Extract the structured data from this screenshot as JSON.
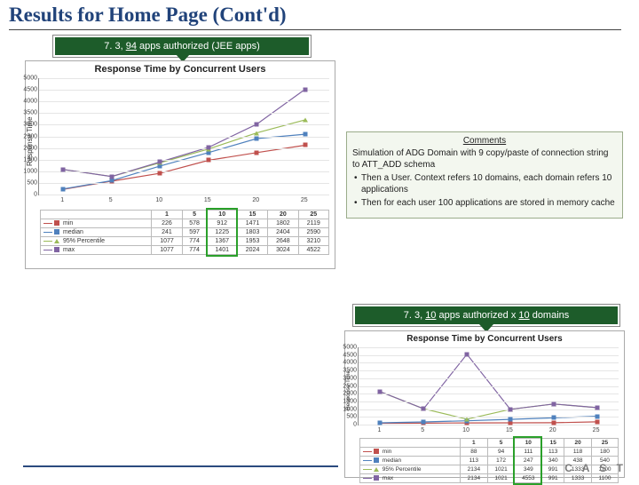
{
  "title": "Results for Home Page (Cont'd)",
  "banner1": {
    "prefix": "7. 3, ",
    "u1": "94",
    "suffix": " apps authorized (JEE apps)"
  },
  "banner2": {
    "prefix": "7. 3,  ",
    "u1": "10",
    "mid": " apps authorized x ",
    "u2": "10",
    "suffix": " domains"
  },
  "comments": {
    "heading": "Comments",
    "p1": "Simulation of ADG Domain with 9 copy/paste of connection string to ATT_ADD schema",
    "li1": "Then a User. Context refers 10 domains, each domain refers 10 applications",
    "li2": "Then for each user 100 applications are stored in memory cache"
  },
  "footer_logo": "C A S T",
  "colors": {
    "min": "#c0504d",
    "median": "#4f81bd",
    "p95": "#9bbb59",
    "max": "#8064a2"
  },
  "chart_data": [
    {
      "type": "line",
      "title": "Response Time by Concurrent Users",
      "ylabel": "Response Time",
      "xlabel": "",
      "categories": [
        1,
        5,
        10,
        15,
        20,
        25
      ],
      "ylim": [
        0,
        5000
      ],
      "yticks": [
        0,
        500,
        1000,
        1500,
        2000,
        2500,
        3000,
        3500,
        4000,
        4500,
        5000
      ],
      "series": [
        {
          "name": "min",
          "color": "#c0504d",
          "values": [
            226,
            578,
            912,
            1471,
            1802,
            2119
          ]
        },
        {
          "name": "median",
          "color": "#4f81bd",
          "values": [
            241,
            597,
            1225,
            1803,
            2404,
            2590
          ]
        },
        {
          "name": "95% Percentile",
          "color": "#9bbb59",
          "values": [
            1077,
            774,
            1367,
            1953,
            2648,
            3210
          ]
        },
        {
          "name": "max",
          "color": "#8064a2",
          "values": [
            1077,
            774,
            1401,
            2024,
            3024,
            4522
          ]
        }
      ],
      "highlight_category_index": 2
    },
    {
      "type": "line",
      "title": "Response Time by Concurrent Users",
      "ylabel": "Response Time",
      "xlabel": "",
      "categories": [
        1,
        5,
        10,
        15,
        20,
        25
      ],
      "ylim": [
        0,
        5000
      ],
      "yticks": [
        0,
        500,
        1000,
        1500,
        2000,
        2500,
        3000,
        3500,
        4000,
        4500,
        5000
      ],
      "series": [
        {
          "name": "min",
          "color": "#c0504d",
          "values": [
            88,
            94,
            111,
            113,
            118,
            180
          ]
        },
        {
          "name": "median",
          "color": "#4f81bd",
          "values": [
            113,
            172,
            247,
            340,
            438,
            540
          ]
        },
        {
          "name": "95% Percentile",
          "color": "#9bbb59",
          "values": [
            2134,
            1021,
            349,
            991,
            1333,
            1100
          ]
        },
        {
          "name": "max",
          "color": "#8064a2",
          "values": [
            2134,
            1021,
            4553,
            991,
            1333,
            1100
          ]
        }
      ],
      "highlight_category_index": 2
    }
  ]
}
